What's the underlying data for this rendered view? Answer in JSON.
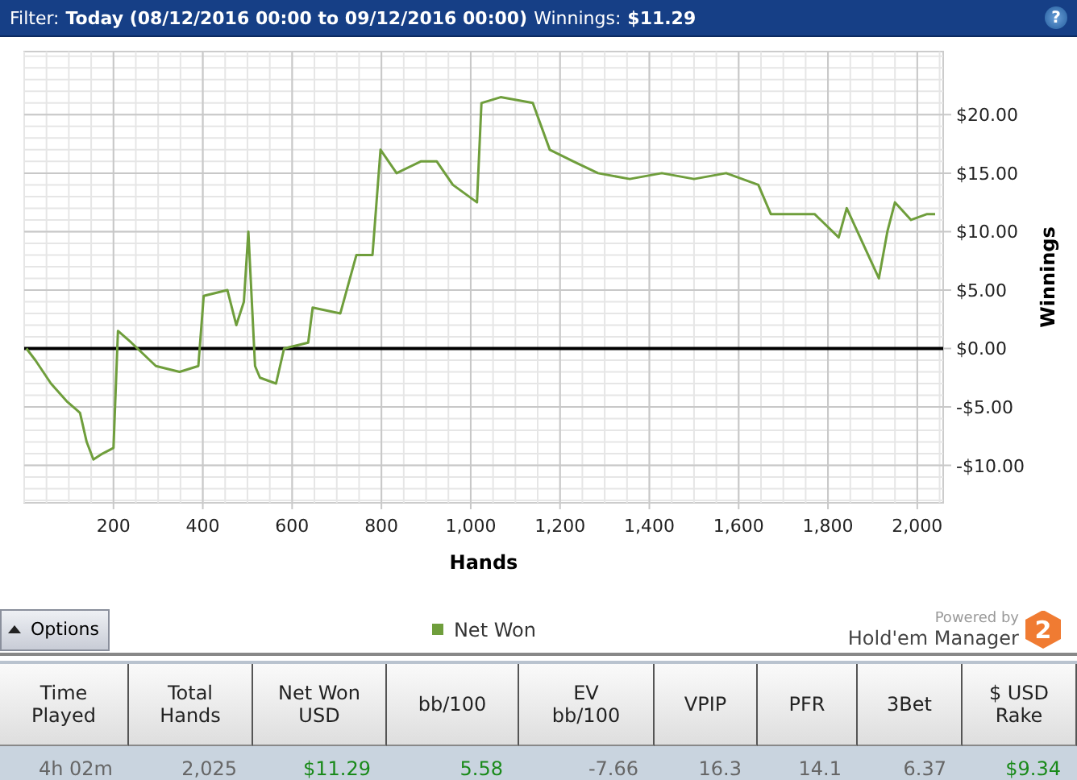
{
  "filter_bar": {
    "filter_label": "Filter:",
    "filter_value": "Today (08/12/2016 00:00 to 09/12/2016 00:00)",
    "winnings_label": "Winnings:",
    "winnings_value": "$11.29",
    "help": "?"
  },
  "chart": {
    "chart_data": {
      "type": "line",
      "grid": true,
      "xlabel": "Hands",
      "ylabel": "Winnings",
      "xlim": [
        0,
        2058
      ],
      "ylim": [
        -13.2,
        25.4
      ],
      "xticks": [
        {
          "value": 200,
          "label": "200"
        },
        {
          "value": 400,
          "label": "400"
        },
        {
          "value": 600,
          "label": "600"
        },
        {
          "value": 800,
          "label": "800"
        },
        {
          "value": 1000,
          "label": "1,000"
        },
        {
          "value": 1200,
          "label": "1,200"
        },
        {
          "value": 1400,
          "label": "1,400"
        },
        {
          "value": 1600,
          "label": "1,600"
        },
        {
          "value": 1800,
          "label": "1,800"
        },
        {
          "value": 2000,
          "label": "2,000"
        }
      ],
      "yticks": [
        {
          "value": -10,
          "label": "-$10.00"
        },
        {
          "value": -5,
          "label": "-$5.00"
        },
        {
          "value": 0,
          "label": "$0.00"
        },
        {
          "value": 5,
          "label": "$5.00"
        },
        {
          "value": 10,
          "label": "$10.00"
        },
        {
          "value": 15,
          "label": "$15.00"
        },
        {
          "value": 20,
          "label": "$20.00"
        }
      ],
      "x": [
        5,
        25,
        60,
        95,
        125,
        140,
        155,
        175,
        200,
        210,
        240,
        295,
        348,
        390,
        402,
        455,
        475,
        492,
        502,
        517,
        528,
        564,
        582,
        636,
        646,
        708,
        744,
        780,
        798,
        834,
        888,
        924,
        960,
        1014,
        1024,
        1067,
        1139,
        1177,
        1230,
        1285,
        1356,
        1428,
        1500,
        1572,
        1644,
        1672,
        1716,
        1770,
        1824,
        1842,
        1878,
        1914,
        1933,
        1950,
        1986,
        2022,
        2040
      ],
      "series": [
        {
          "name": "Net Won",
          "color": "#6f9e3c",
          "values": [
            0,
            -1,
            -3,
            -4.5,
            -5.5,
            -8,
            -9.5,
            -9,
            -8.5,
            1.5,
            0.5,
            -1.5,
            -2,
            -1.5,
            4.5,
            5,
            2,
            4,
            10,
            -1.5,
            -2.5,
            -3,
            0,
            0.5,
            3.5,
            3,
            8,
            8,
            17,
            15,
            16,
            16,
            14,
            12.5,
            21,
            21.5,
            21,
            17,
            16,
            15,
            14.5,
            15,
            14.5,
            15,
            14,
            11.5,
            11.5,
            11.5,
            9.5,
            12,
            9,
            6,
            10,
            12.5,
            11,
            11.5,
            11.5
          ]
        }
      ]
    }
  },
  "toolbar": {
    "options_button": "Options",
    "powered_by": "Powered by",
    "brand": "Hold'em Manager",
    "brand_badge": "2"
  },
  "table": {
    "columns": [
      {
        "header": "Time Played",
        "value": "4h 02m",
        "color": "#666666"
      },
      {
        "header": "Total Hands",
        "value": "2,025",
        "color": "#666666"
      },
      {
        "header": "Net Won USD",
        "value": "$11.29",
        "color": "#1a8a1a"
      },
      {
        "header": "bb/100",
        "value": "5.58",
        "color": "#1a8a1a"
      },
      {
        "header": "EV bb/100",
        "value": "-7.66",
        "color": "#666666"
      },
      {
        "header": "VPIP",
        "value": "16.3",
        "color": "#666666"
      },
      {
        "header": "PFR",
        "value": "14.1",
        "color": "#666666"
      },
      {
        "header": "3Bet",
        "value": "6.37",
        "color": "#666666"
      },
      {
        "header": "$ USD Rake",
        "value": "$9.34",
        "color": "#1a8a1a"
      }
    ]
  }
}
